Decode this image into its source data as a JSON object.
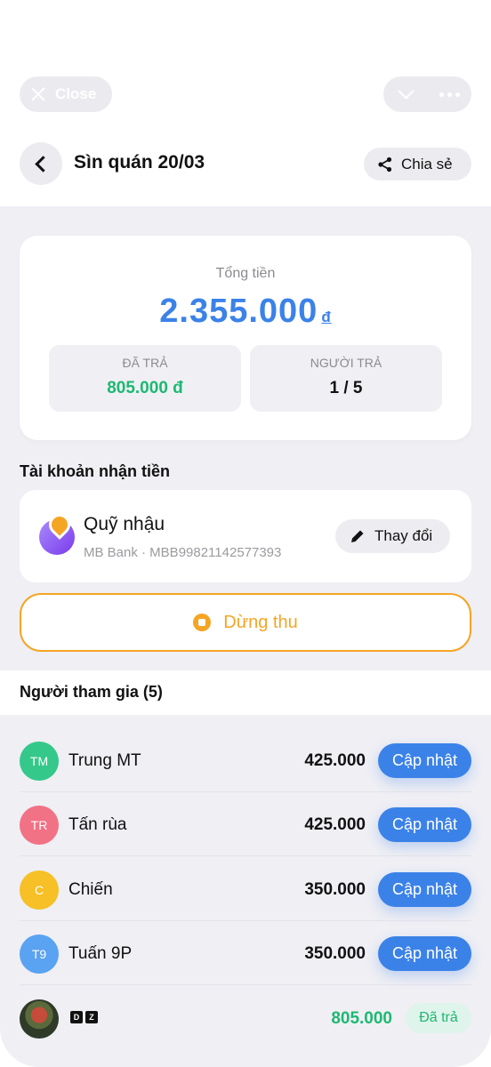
{
  "topbar": {
    "close_label": "Close",
    "back_icon": "chevron-left-icon",
    "title": "Sìn quán 20/03",
    "share_label": "Chia sẻ"
  },
  "summary": {
    "total_label": "Tổng tiền",
    "total_amount": "2.355.000",
    "currency": "đ",
    "paid_label": "ĐÃ TRẢ",
    "paid_value": "805.000 đ",
    "payers_label": "NGƯỜI TRẢ",
    "payers_value": "1 / 5"
  },
  "account": {
    "section_title": "Tài khoản nhận tiền",
    "name": "Quỹ nhậu",
    "detail": "MB Bank · MBB99821142577393",
    "change_label": "Thay đổi"
  },
  "stop_label": "Dừng thu",
  "participants": {
    "title": "Người tham gia (5)",
    "update_label": "Cập nhật",
    "paid_badge": "Đã trả",
    "items": [
      {
        "initials": "TM",
        "name": "Trung MT",
        "amount": "425.000",
        "color": "#34c88a"
      },
      {
        "initials": "TR",
        "name": "Tấn rùa",
        "amount": "425.000",
        "color": "#f27285"
      },
      {
        "initials": "C",
        "name": "Chiến",
        "amount": "350.000",
        "color": "#f6c026"
      },
      {
        "initials": "T9",
        "name": "Tuấn 9P",
        "amount": "350.000",
        "color": "#5aa2f2"
      },
      {
        "name_glyphs": [
          "D",
          "Z"
        ],
        "amount": "805.000"
      }
    ]
  },
  "colors": {
    "primary": "#3b82e8",
    "success": "#1db872",
    "warning": "#f5a524",
    "background": "#efeff4"
  }
}
